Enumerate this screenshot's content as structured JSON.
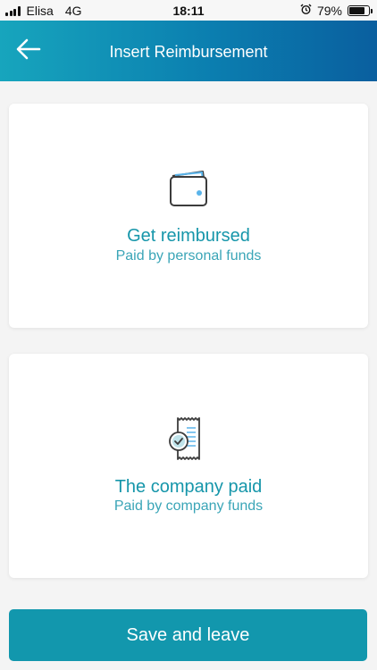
{
  "status_bar": {
    "carrier": "Elisa",
    "network": "4G",
    "time": "18:11",
    "battery_percent": "79%",
    "battery_level": 0.79
  },
  "header": {
    "title": "Insert Reimbursement",
    "back_icon": "arrow-left-icon"
  },
  "options": [
    {
      "icon": "wallet-icon",
      "title": "Get reimbursed",
      "subtitle": "Paid by personal funds"
    },
    {
      "icon": "receipt-check-icon",
      "title": "The company paid",
      "subtitle": "Paid by company funds"
    }
  ],
  "footer": {
    "save_label": "Save and leave"
  },
  "colors": {
    "accent": "#1696aa",
    "header_start": "#17a5bd",
    "header_end": "#0a5f9f",
    "button": "#1297ad"
  }
}
